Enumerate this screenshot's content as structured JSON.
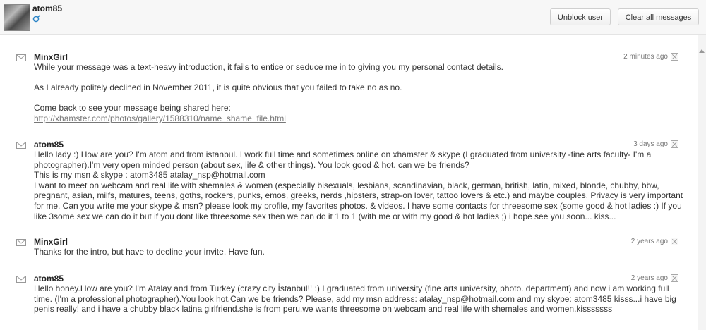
{
  "header": {
    "username": "atom85",
    "gender_icon": "male-symbol-icon",
    "unblock_label": "Unblock user",
    "clear_label": "Clear all messages"
  },
  "messages": [
    {
      "sender": "MinxGirl",
      "time": "2 minutes ago",
      "lines": [
        "While your message was a text-heavy introduction, it fails to entice or seduce me in to giving you my personal contact details.",
        "As I already politely declined in November 2011, it is quite obvious that you failed to take no as no.",
        "Come back to see your message being shared here:"
      ],
      "link": "http://xhamster.com/photos/gallery/1588310/name_shame_file.html"
    },
    {
      "sender": "atom85",
      "time": "3 days ago",
      "lines": [
        "Hello lady :) How are you? I'm atom and from istanbul. I work full time and sometimes online on xhamster & skype (I graduated from university -fine arts faculty- I'm a photographer).I'm very open minded person (about sex, life & other things). You look good & hot. can we be friends?",
        "This is my msn & skype : atom3485 atalay_nsp@hotmail.com",
        "I want to meet on webcam and real life with shemales & women (especially bisexuals, lesbians, scandinavian, black, german, british, latin, mixed, blonde, chubby, bbw, pregnant, asian, milfs, matures, teens, goths, rockers, punks, emos, greeks, nerds ,hipsters, strap-on lover, tattoo lovers & etc.) and maybe couples. Privacy is very important for me. Can you write me your skype & msn? please look my profile, my favorites photos. & videos. I have some contacts for threesome sex (some good & hot ladies :) If you like 3some sex we can do it but if you dont like threesome sex then we can do it 1 to 1 (with me or with my good & hot ladies ;) i hope see you soon... kiss..."
      ]
    },
    {
      "sender": "MinxGirl",
      "time": "2 years ago",
      "lines": [
        "Thanks for the intro, but have to decline your invite. Have fun."
      ]
    },
    {
      "sender": "atom85",
      "time": "2 years ago",
      "lines": [
        "Hello honey.How are you? I'm Atalay and from Turkey (crazy city İstanbul!! :) I graduated from university (fine arts university, photo. department) and now i am working full time. (I'm a professional photographer).You look hot.Can we be friends? Please, add my msn address: atalay_nsp@hotmail.com and my skype: atom3485 kisss...i have big penis really! and i have a chubby black latina girlfriend.she is from peru.we wants threesome on webcam and real life with shemales and women.kisssssss"
      ]
    }
  ]
}
